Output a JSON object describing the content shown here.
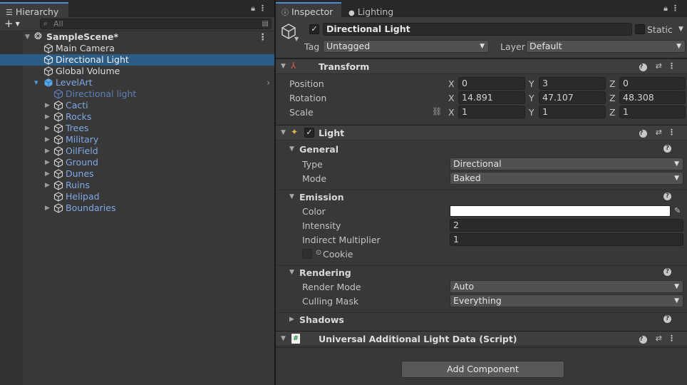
{
  "hierarchy": {
    "tab_label": "Hierarchy",
    "search_placeholder": "All",
    "scene_name": "SampleScene*",
    "items": [
      {
        "label": "Main Camera"
      },
      {
        "label": "Directional Light"
      },
      {
        "label": "Global Volume"
      },
      {
        "label": "LevelArt"
      },
      {
        "label": "Directional light"
      },
      {
        "label": "Cacti"
      },
      {
        "label": "Rocks"
      },
      {
        "label": "Trees"
      },
      {
        "label": "Military"
      },
      {
        "label": "OilField"
      },
      {
        "label": "Ground"
      },
      {
        "label": "Dunes"
      },
      {
        "label": "Ruins"
      },
      {
        "label": "Helipad"
      },
      {
        "label": "Boundaries"
      }
    ]
  },
  "inspector": {
    "tab_inspector": "Inspector",
    "tab_lighting": "Lighting",
    "object_name": "Directional Light",
    "static_label": "Static",
    "tag_label": "Tag",
    "tag_value": "Untagged",
    "layer_label": "Layer",
    "layer_value": "Default",
    "transform": {
      "title": "Transform",
      "position_label": "Position",
      "rotation_label": "Rotation",
      "scale_label": "Scale",
      "axis_x": "X",
      "axis_y": "Y",
      "axis_z": "Z",
      "position": {
        "x": "0",
        "y": "3",
        "z": "0"
      },
      "rotation": {
        "x": "14.891",
        "y": "47.107",
        "z": "48.308"
      },
      "scale": {
        "x": "1",
        "y": "1",
        "z": "1"
      }
    },
    "light": {
      "title": "Light",
      "general_title": "General",
      "type_label": "Type",
      "type_value": "Directional",
      "mode_label": "Mode",
      "mode_value": "Baked",
      "emission_title": "Emission",
      "color_label": "Color",
      "color_value": "#ffffff",
      "intensity_label": "Intensity",
      "intensity_value": "2",
      "indirect_label": "Indirect Multiplier",
      "indirect_value": "1",
      "cookie_label": "Cookie",
      "rendering_title": "Rendering",
      "render_mode_label": "Render Mode",
      "render_mode_value": "Auto",
      "culling_label": "Culling Mask",
      "culling_value": "Everything",
      "shadows_title": "Shadows"
    },
    "script_title": "Universal Additional Light Data (Script)",
    "add_component": "Add Component"
  },
  "colors": {
    "selection": "#2c5d87",
    "prefab_blue": "#7fa8e6",
    "tab_accent": "#4c8dd6"
  }
}
